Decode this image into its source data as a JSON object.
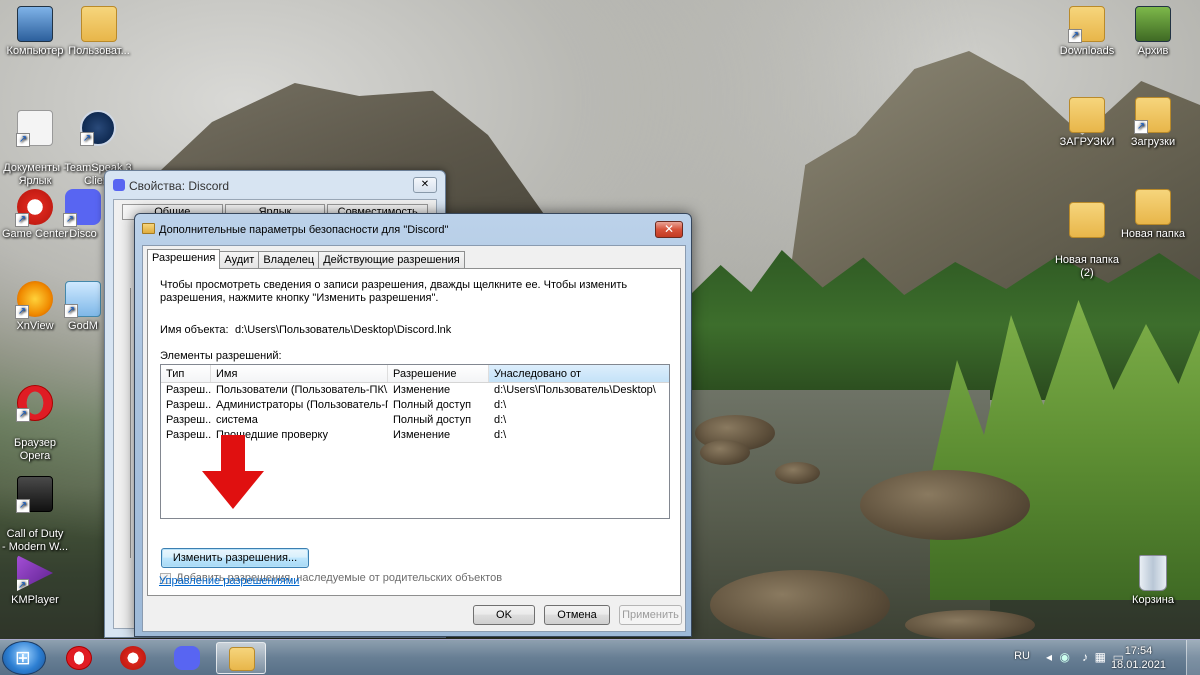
{
  "desktop": {
    "icons_left": [
      {
        "label": "Компьютер",
        "icon": "computer-icon"
      },
      {
        "label": "Пользоват...",
        "icon": "user-folder-icon"
      },
      {
        "label": "Документы -\nЯрлык",
        "icon": "documents-shortcut-icon"
      },
      {
        "label": "TeamSpeak 3\nClient",
        "icon": "teamspeak-icon"
      },
      {
        "label": "Game Center",
        "icon": "game-center-icon"
      },
      {
        "label": "Disco",
        "icon": "discord-icon"
      },
      {
        "label": "XnView",
        "icon": "xnview-icon"
      },
      {
        "label": "GodM",
        "icon": "godmode-icon"
      },
      {
        "label": "Браузер\nOpera",
        "icon": "opera-icon"
      },
      {
        "label": "Call of Duty\n- Modern W...",
        "icon": "call-of-duty-icon"
      },
      {
        "label": "KMPlayer",
        "icon": "kmplayer-icon"
      }
    ],
    "icons_right": [
      {
        "label": "Downloads",
        "icon": "downloads-folder-icon"
      },
      {
        "label": "Архив",
        "icon": "archive-icon"
      },
      {
        "label": "ЗАГРУЗКИ",
        "icon": "folder-icon"
      },
      {
        "label": "Загрузки",
        "icon": "folder-icon"
      },
      {
        "label": "Новая папка\n(2)",
        "icon": "folder-icon"
      },
      {
        "label": "Новая папка",
        "icon": "folder-icon"
      },
      {
        "label": "Корзина",
        "icon": "recycle-bin-icon"
      }
    ]
  },
  "props_window": {
    "title": "Свойства: Discord",
    "tabs": [
      "Общие",
      "Ярлык",
      "Совместимость"
    ]
  },
  "dialog": {
    "title": "Дополнительные параметры безопасности  для \"Discord\"",
    "close_symbol": "✕",
    "tabs": [
      "Разрешения",
      "Аудит",
      "Владелец",
      "Действующие разрешения"
    ],
    "description": "Чтобы просмотреть сведения о записи разрешения, дважды щелкните ее. Чтобы изменить разрешения, нажмите кнопку \"Изменить разрешения\".",
    "object_label": "Имя объекта:",
    "object_value": "d:\\Users\\Пользователь\\Desktop\\Discord.lnk",
    "entries_label": "Элементы разрешений:",
    "columns": [
      "Тип",
      "Имя",
      "Разрешение",
      "Унаследовано от"
    ],
    "rows": [
      [
        "Разреш...",
        "Пользователи (Пользователь-ПК\\...",
        "Изменение",
        "d:\\Users\\Пользователь\\Desktop\\"
      ],
      [
        "Разреш...",
        "Администраторы (Пользователь-П...",
        "Полный доступ",
        "d:\\"
      ],
      [
        "Разреш...",
        "система",
        "Полный доступ",
        "d:\\"
      ],
      [
        "Разреш...",
        "Прошедшие проверку",
        "Изменение",
        "d:\\"
      ]
    ],
    "change_button": "Изменить разрешения...",
    "inherit_checkbox": "Добавить разрешения, наследуемые от родительских объектов",
    "inherit_checked": true,
    "manage_link": "Управление разрешениями",
    "ok": "OK",
    "cancel": "Отмена",
    "apply": "Применить"
  },
  "taskbar": {
    "apps": [
      "start-button",
      "opera",
      "game-center",
      "discord",
      "explorer"
    ],
    "language": "RU",
    "time": "17:54",
    "date": "18.01.2021"
  },
  "colors": {
    "arrow": "#e01010",
    "link": "#0066cc",
    "discord": "#5865f2",
    "opera": "#e01c24"
  }
}
